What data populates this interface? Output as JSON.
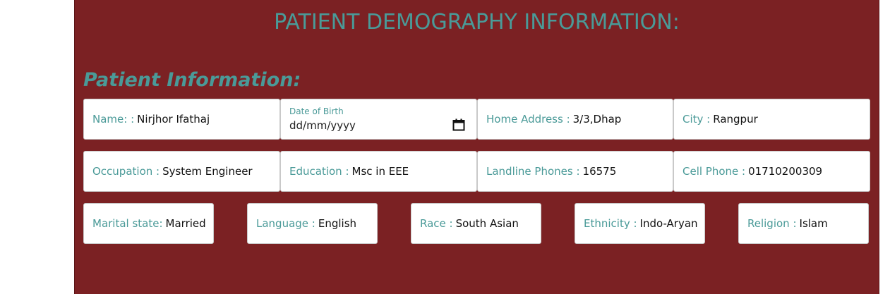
{
  "page_title": "PATIENT DEMOGRAPHY INFORMATION:",
  "section_title": "Patient Information:",
  "row1": {
    "name": {
      "label": "Name: :",
      "value": "Nirjhor Ifathaj"
    },
    "dob": {
      "label": "Date of Birth",
      "placeholder": "dd/mm/yyyy"
    },
    "address": {
      "label": "Home Address :",
      "value": "3/3,Dhap"
    },
    "city": {
      "label": "City :",
      "value": "Rangpur"
    }
  },
  "row2": {
    "occupation": {
      "label": "Occupation :",
      "value": "System Engineer"
    },
    "education": {
      "label": "Education :",
      "value": "Msc in EEE"
    },
    "landline": {
      "label": "Landline Phones :",
      "value": "16575"
    },
    "cell": {
      "label": "Cell Phone :",
      "value": "01710200309"
    }
  },
  "row3": {
    "marital": {
      "label": "Marital state:",
      "value": "Married"
    },
    "language": {
      "label": "Language :",
      "value": "English"
    },
    "race": {
      "label": "Race :",
      "value": "South Asian"
    },
    "ethnicity": {
      "label": "Ethnicity :",
      "value": "Indo-Aryan"
    },
    "religion": {
      "label": "Religion :",
      "value": "Islam"
    }
  },
  "colors": {
    "panel_bg": "#7b2123",
    "accent": "#4a9a98"
  },
  "icons": {
    "dob": "calendar-icon"
  }
}
